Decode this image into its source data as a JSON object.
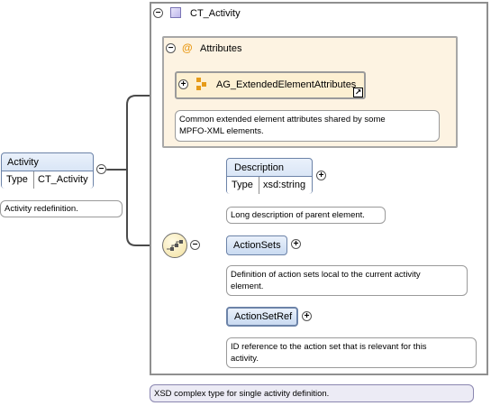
{
  "complex_type": {
    "name": "CT_Activity",
    "toggle": "−",
    "note": "XSD complex type for single activity definition."
  },
  "attributes": {
    "title": "Attributes",
    "at_symbol": "@",
    "toggle": "−",
    "group": {
      "name": "AG_ExtendedElementAttributes",
      "toggle": "+",
      "note_line1": "Common extended element attributes shared by some",
      "note_line2": "MPFO-XML elements."
    }
  },
  "root_element": {
    "name": "Activity",
    "type_label": "Type",
    "type_value": "CT_Activity",
    "toggle": "−",
    "note": "Activity redefinition."
  },
  "sequence": {
    "toggle": "−",
    "icon": "sequence-compositor-icon"
  },
  "children": [
    {
      "name": "Description",
      "type_label": "Type",
      "type_value": "xsd:string",
      "toggle": "+",
      "note_line1": "Long description of parent element."
    },
    {
      "name": "ActionSets",
      "toggle": "+",
      "note_line1": "Definition of action sets local to the current activity",
      "note_line2": "element."
    },
    {
      "name": "ActionSetRef",
      "toggle": "+",
      "note_line1": "ID reference to the action set that is relevant for this",
      "note_line2": "activity."
    }
  ],
  "colors": {
    "element_fill": "#c9daf1",
    "attribute_fill": "#fdf3e2",
    "complex_type_note_fill": "#ecebf5",
    "attribute_icon": "#e69b18"
  }
}
